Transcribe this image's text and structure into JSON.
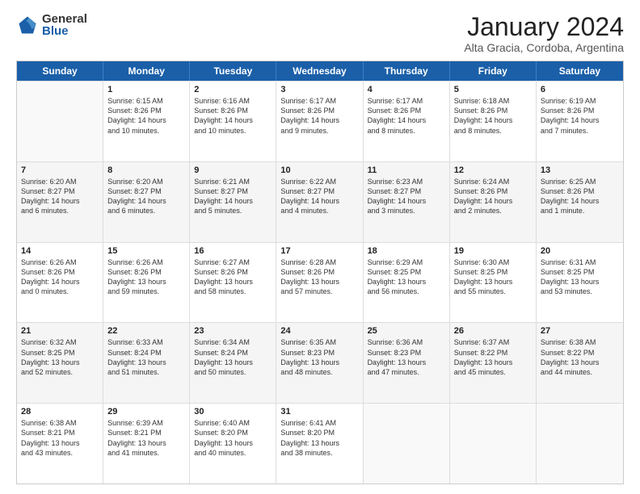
{
  "logo": {
    "general": "General",
    "blue": "Blue"
  },
  "title": {
    "main": "January 2024",
    "sub": "Alta Gracia, Cordoba, Argentina"
  },
  "days": [
    "Sunday",
    "Monday",
    "Tuesday",
    "Wednesday",
    "Thursday",
    "Friday",
    "Saturday"
  ],
  "weeks": [
    [
      {
        "day": "",
        "info": ""
      },
      {
        "day": "1",
        "info": "Sunrise: 6:15 AM\nSunset: 8:26 PM\nDaylight: 14 hours\nand 10 minutes."
      },
      {
        "day": "2",
        "info": "Sunrise: 6:16 AM\nSunset: 8:26 PM\nDaylight: 14 hours\nand 10 minutes."
      },
      {
        "day": "3",
        "info": "Sunrise: 6:17 AM\nSunset: 8:26 PM\nDaylight: 14 hours\nand 9 minutes."
      },
      {
        "day": "4",
        "info": "Sunrise: 6:17 AM\nSunset: 8:26 PM\nDaylight: 14 hours\nand 8 minutes."
      },
      {
        "day": "5",
        "info": "Sunrise: 6:18 AM\nSunset: 8:26 PM\nDaylight: 14 hours\nand 8 minutes."
      },
      {
        "day": "6",
        "info": "Sunrise: 6:19 AM\nSunset: 8:26 PM\nDaylight: 14 hours\nand 7 minutes."
      }
    ],
    [
      {
        "day": "7",
        "info": "Sunrise: 6:20 AM\nSunset: 8:27 PM\nDaylight: 14 hours\nand 6 minutes."
      },
      {
        "day": "8",
        "info": "Sunrise: 6:20 AM\nSunset: 8:27 PM\nDaylight: 14 hours\nand 6 minutes."
      },
      {
        "day": "9",
        "info": "Sunrise: 6:21 AM\nSunset: 8:27 PM\nDaylight: 14 hours\nand 5 minutes."
      },
      {
        "day": "10",
        "info": "Sunrise: 6:22 AM\nSunset: 8:27 PM\nDaylight: 14 hours\nand 4 minutes."
      },
      {
        "day": "11",
        "info": "Sunrise: 6:23 AM\nSunset: 8:27 PM\nDaylight: 14 hours\nand 3 minutes."
      },
      {
        "day": "12",
        "info": "Sunrise: 6:24 AM\nSunset: 8:26 PM\nDaylight: 14 hours\nand 2 minutes."
      },
      {
        "day": "13",
        "info": "Sunrise: 6:25 AM\nSunset: 8:26 PM\nDaylight: 14 hours\nand 1 minute."
      }
    ],
    [
      {
        "day": "14",
        "info": "Sunrise: 6:26 AM\nSunset: 8:26 PM\nDaylight: 14 hours\nand 0 minutes."
      },
      {
        "day": "15",
        "info": "Sunrise: 6:26 AM\nSunset: 8:26 PM\nDaylight: 13 hours\nand 59 minutes."
      },
      {
        "day": "16",
        "info": "Sunrise: 6:27 AM\nSunset: 8:26 PM\nDaylight: 13 hours\nand 58 minutes."
      },
      {
        "day": "17",
        "info": "Sunrise: 6:28 AM\nSunset: 8:26 PM\nDaylight: 13 hours\nand 57 minutes."
      },
      {
        "day": "18",
        "info": "Sunrise: 6:29 AM\nSunset: 8:25 PM\nDaylight: 13 hours\nand 56 minutes."
      },
      {
        "day": "19",
        "info": "Sunrise: 6:30 AM\nSunset: 8:25 PM\nDaylight: 13 hours\nand 55 minutes."
      },
      {
        "day": "20",
        "info": "Sunrise: 6:31 AM\nSunset: 8:25 PM\nDaylight: 13 hours\nand 53 minutes."
      }
    ],
    [
      {
        "day": "21",
        "info": "Sunrise: 6:32 AM\nSunset: 8:25 PM\nDaylight: 13 hours\nand 52 minutes."
      },
      {
        "day": "22",
        "info": "Sunrise: 6:33 AM\nSunset: 8:24 PM\nDaylight: 13 hours\nand 51 minutes."
      },
      {
        "day": "23",
        "info": "Sunrise: 6:34 AM\nSunset: 8:24 PM\nDaylight: 13 hours\nand 50 minutes."
      },
      {
        "day": "24",
        "info": "Sunrise: 6:35 AM\nSunset: 8:23 PM\nDaylight: 13 hours\nand 48 minutes."
      },
      {
        "day": "25",
        "info": "Sunrise: 6:36 AM\nSunset: 8:23 PM\nDaylight: 13 hours\nand 47 minutes."
      },
      {
        "day": "26",
        "info": "Sunrise: 6:37 AM\nSunset: 8:22 PM\nDaylight: 13 hours\nand 45 minutes."
      },
      {
        "day": "27",
        "info": "Sunrise: 6:38 AM\nSunset: 8:22 PM\nDaylight: 13 hours\nand 44 minutes."
      }
    ],
    [
      {
        "day": "28",
        "info": "Sunrise: 6:38 AM\nSunset: 8:21 PM\nDaylight: 13 hours\nand 43 minutes."
      },
      {
        "day": "29",
        "info": "Sunrise: 6:39 AM\nSunset: 8:21 PM\nDaylight: 13 hours\nand 41 minutes."
      },
      {
        "day": "30",
        "info": "Sunrise: 6:40 AM\nSunset: 8:20 PM\nDaylight: 13 hours\nand 40 minutes."
      },
      {
        "day": "31",
        "info": "Sunrise: 6:41 AM\nSunset: 8:20 PM\nDaylight: 13 hours\nand 38 minutes."
      },
      {
        "day": "",
        "info": ""
      },
      {
        "day": "",
        "info": ""
      },
      {
        "day": "",
        "info": ""
      }
    ]
  ]
}
